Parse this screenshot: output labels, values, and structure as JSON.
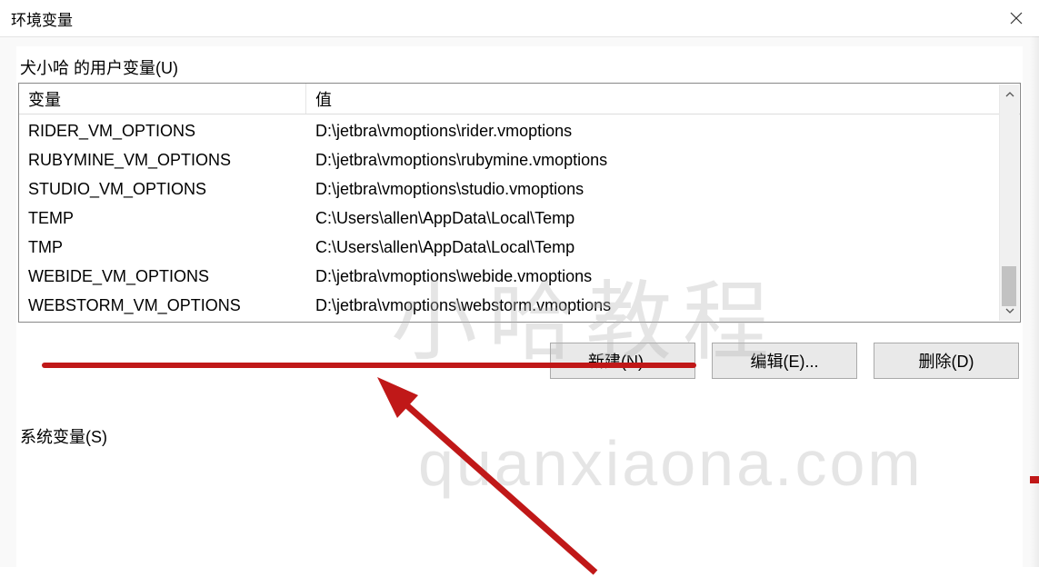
{
  "title": "环境变量",
  "user_vars": {
    "section_label": "犬小哈 的用户变量(U)",
    "headers": {
      "name": "变量",
      "value": "值"
    },
    "rows": [
      {
        "name": "RIDER_VM_OPTIONS",
        "value": "D:\\jetbra\\vmoptions\\rider.vmoptions"
      },
      {
        "name": "RUBYMINE_VM_OPTIONS",
        "value": "D:\\jetbra\\vmoptions\\rubymine.vmoptions"
      },
      {
        "name": "STUDIO_VM_OPTIONS",
        "value": "D:\\jetbra\\vmoptions\\studio.vmoptions"
      },
      {
        "name": "TEMP",
        "value": "C:\\Users\\allen\\AppData\\Local\\Temp"
      },
      {
        "name": "TMP",
        "value": "C:\\Users\\allen\\AppData\\Local\\Temp"
      },
      {
        "name": "WEBIDE_VM_OPTIONS",
        "value": "D:\\jetbra\\vmoptions\\webide.vmoptions"
      },
      {
        "name": "WEBSTORM_VM_OPTIONS",
        "value": "D:\\jetbra\\vmoptions\\webstorm.vmoptions"
      }
    ]
  },
  "buttons": {
    "new": "新建(N)...",
    "edit": "编辑(E)...",
    "delete": "删除(D)"
  },
  "system_vars_label": "系统变量(S)",
  "watermarks": {
    "top": "小哈教程",
    "bottom": "quanxiaona.com"
  }
}
